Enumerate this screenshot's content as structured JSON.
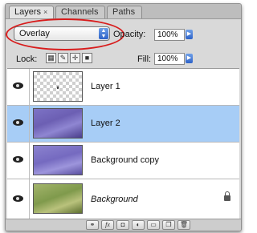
{
  "tabs": [
    {
      "label": "Layers",
      "close": "×"
    },
    {
      "label": "Channels"
    },
    {
      "label": "Paths"
    }
  ],
  "blend_mode": {
    "value": "Overlay",
    "stepper": "⬍"
  },
  "opacity": {
    "label": "Opacity:",
    "value": "100%"
  },
  "lock": {
    "label": "Lock:"
  },
  "fill": {
    "label": "Fill:",
    "value": "100%"
  },
  "layers": [
    {
      "name": "Layer 1"
    },
    {
      "name": "Layer 2"
    },
    {
      "name": "Background copy"
    },
    {
      "name": "Background"
    }
  ],
  "footer": {
    "fx_label": "fx"
  },
  "colors": {
    "selection": "#a7cdf6",
    "highlight_oval": "#d81c1c",
    "stepper_blue": "#2d62c8"
  },
  "icons": [
    "eye-icon",
    "lock-icon",
    "link-icon",
    "fx-icon",
    "mask-icon",
    "adjustment-icon",
    "group-icon",
    "new-layer-icon",
    "trash-icon"
  ]
}
